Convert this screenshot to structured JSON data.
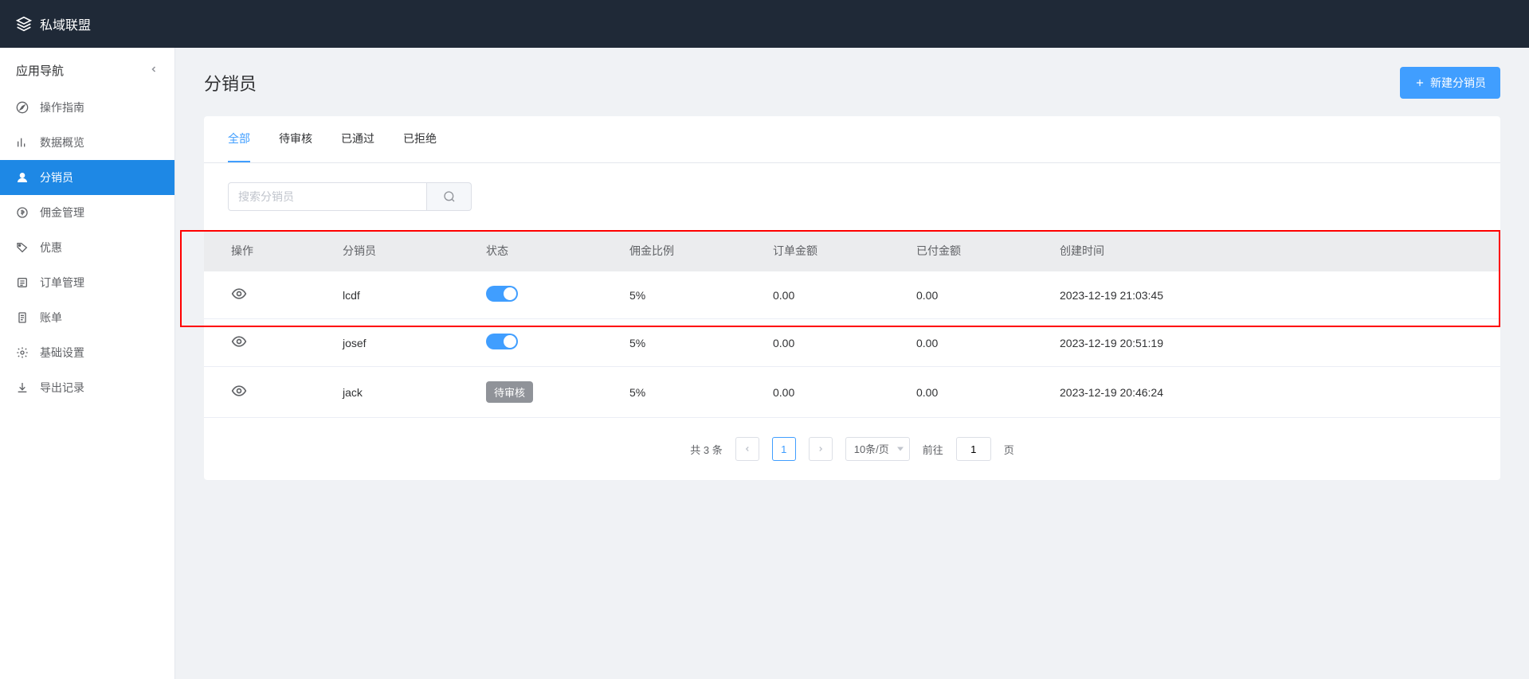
{
  "header": {
    "title": "私域联盟"
  },
  "sidebar": {
    "title": "应用导航",
    "items": [
      {
        "icon": "compass",
        "label": "操作指南"
      },
      {
        "icon": "chart",
        "label": "数据概览"
      },
      {
        "icon": "user",
        "label": "分销员"
      },
      {
        "icon": "coin",
        "label": "佣金管理"
      },
      {
        "icon": "tag",
        "label": "优惠"
      },
      {
        "icon": "list",
        "label": "订单管理"
      },
      {
        "icon": "doc",
        "label": "账单"
      },
      {
        "icon": "gear",
        "label": "基础设置"
      },
      {
        "icon": "download",
        "label": "导出记录"
      }
    ]
  },
  "page": {
    "title": "分销员",
    "create_btn": "新建分销员"
  },
  "tabs": [
    {
      "label": "全部",
      "active": true
    },
    {
      "label": "待审核",
      "active": false
    },
    {
      "label": "已通过",
      "active": false
    },
    {
      "label": "已拒绝",
      "active": false
    }
  ],
  "search": {
    "placeholder": "搜索分销员"
  },
  "table": {
    "columns": [
      "操作",
      "分销员",
      "状态",
      "佣金比例",
      "订单金额",
      "已付金额",
      "创建时间"
    ],
    "rows": [
      {
        "name": "lcdf",
        "status_type": "switch",
        "status_label": "",
        "rate": "5%",
        "order_amount": "0.00",
        "paid_amount": "0.00",
        "created": "2023-12-19 21:03:45"
      },
      {
        "name": "josef",
        "status_type": "switch",
        "status_label": "",
        "rate": "5%",
        "order_amount": "0.00",
        "paid_amount": "0.00",
        "created": "2023-12-19 20:51:19"
      },
      {
        "name": "jack",
        "status_type": "badge",
        "status_label": "待审核",
        "rate": "5%",
        "order_amount": "0.00",
        "paid_amount": "0.00",
        "created": "2023-12-19 20:46:24"
      }
    ]
  },
  "pagination": {
    "total_text": "共 3 条",
    "current": "1",
    "page_size": "10条/页",
    "goto_prefix": "前往",
    "goto_value": "1",
    "goto_suffix": "页"
  }
}
